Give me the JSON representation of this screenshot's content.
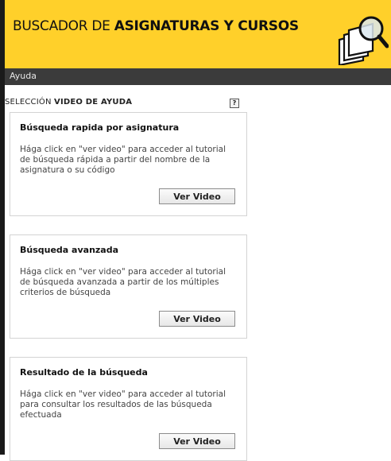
{
  "header": {
    "title_light": "BUSCADOR DE ",
    "title_bold": "ASIGNATURAS Y CURSOS",
    "icon": "search-documents-icon",
    "accent_color": "#ffd02a"
  },
  "nav": {
    "items": [
      {
        "label": "Ayuda"
      }
    ]
  },
  "section": {
    "prefix": "SELECCIÓN ",
    "title": "VIDEO DE AYUDA",
    "help_icon_label": "?"
  },
  "cards": [
    {
      "title": "Búsqueda rapida por asignatura",
      "description": "Hága click en \"ver video\" para acceder al tutorial de búsqueda rápida a partir del nombre de la asignatura o su código",
      "button_label": "Ver Video"
    },
    {
      "title": "Búsqueda avanzada",
      "description": "Hága click en \"ver video\" para acceder al tutorial de búsqueda avanzada a partir de los múltiples criterios de búsqueda",
      "button_label": "Ver Video"
    },
    {
      "title": "Resultado de la búsqueda",
      "description": "Hága click en \"ver video\" para acceder al tutorial para consultar los resultados de las búsqueda efectuada",
      "button_label": "Ver Video"
    }
  ]
}
